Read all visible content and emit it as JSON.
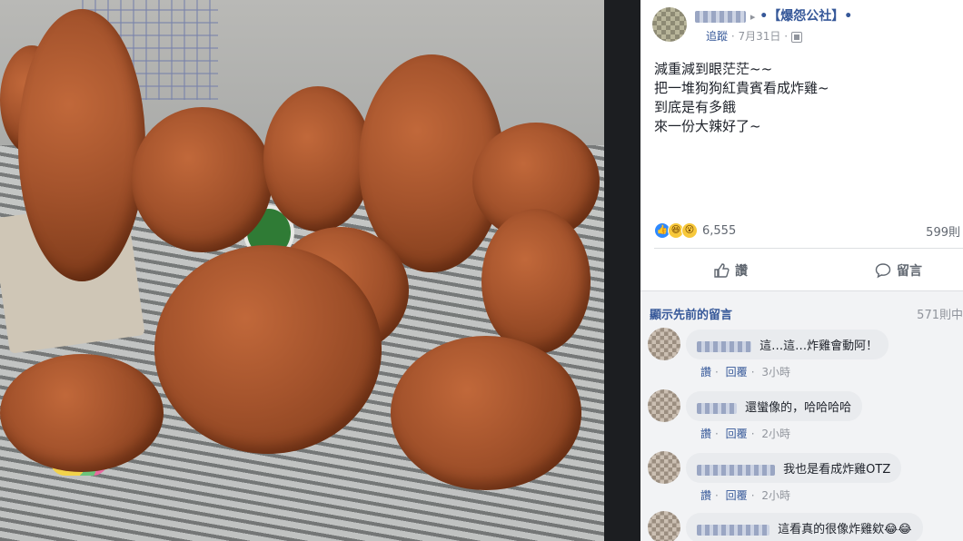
{
  "post": {
    "page_name": "•【爆怨公社】•",
    "follow": "追蹤",
    "date": "7月31日",
    "text_lines": [
      "減重減到眼茫茫~~",
      "把一堆狗狗紅貴賓看成炸雞~",
      "到底是有多餓",
      "來一份大辣好了~"
    ],
    "reactions": {
      "icons": [
        "like",
        "haha",
        "wow"
      ],
      "count": "6,555"
    },
    "comments_total": "599則",
    "actions": {
      "like_label": "讚",
      "comment_label": "留言"
    }
  },
  "comments_section": {
    "previous_label": "顯示先前的留言",
    "previous_count": "571則中",
    "items": [
      {
        "text": "這…這…炸雞會動阿！",
        "like": "讚",
        "reply": "回覆",
        "time": "3小時"
      },
      {
        "text": "還蠻像的，哈哈哈哈",
        "like": "讚",
        "reply": "回覆",
        "time": "2小時"
      },
      {
        "text": "我也是看成炸雞OTZ",
        "like": "讚",
        "reply": "回覆",
        "time": "2小時"
      },
      {
        "text": "這看真的很像炸雞欸😂😂",
        "like": "",
        "reply": "",
        "time": ""
      }
    ]
  },
  "colors": {
    "link": "#365899",
    "meta": "#90949c",
    "bubble": "#e9ebee",
    "like_blue": "#2e89ff"
  },
  "photo": {
    "icon": "dogs-photo"
  }
}
